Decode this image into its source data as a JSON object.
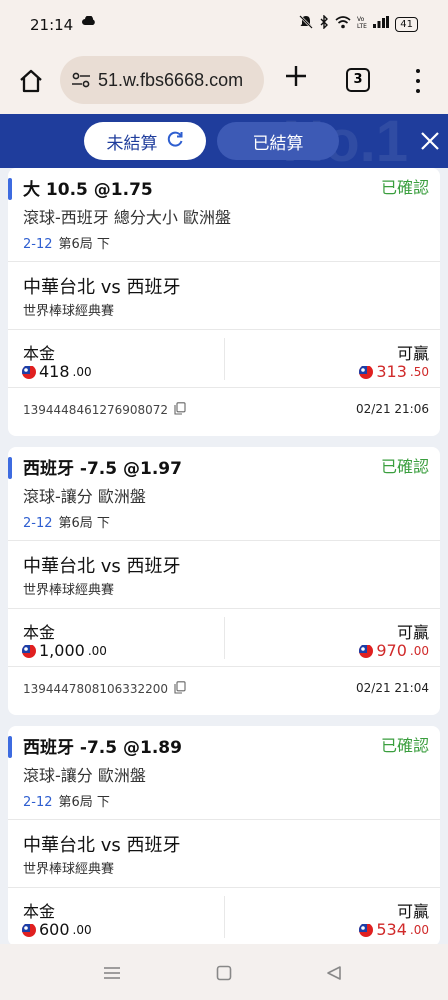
{
  "status_bar": {
    "time": "21:14",
    "battery": "41"
  },
  "browser": {
    "url": "51.w.fbs6668.com",
    "tab_count": "3"
  },
  "tabs": {
    "unsettled": "未結算",
    "settled": "已結算"
  },
  "watermark": "No.1",
  "labels": {
    "stake": "本金",
    "payout": "可贏"
  },
  "bets": [
    {
      "title": "大 10.5 @1.75",
      "status": "已確認",
      "market": "滾球-西班牙 總分大小 歐洲盤",
      "score": "2-12",
      "inning": "第6局 下",
      "match": "中華台北 vs 西班牙",
      "league": "世界棒球經典賽",
      "stake_int": "418",
      "stake_dec": ".00",
      "payout_int": "313",
      "payout_dec": ".50",
      "ticket_id": "1394448461276908072",
      "time": "02/21 21:06"
    },
    {
      "title": "西班牙 -7.5 @1.97",
      "status": "已確認",
      "market": "滾球-讓分 歐洲盤",
      "score": "2-12",
      "inning": "第6局 下",
      "match": "中華台北 vs 西班牙",
      "league": "世界棒球經典賽",
      "stake_int": "1,000",
      "stake_dec": ".00",
      "payout_int": "970",
      "payout_dec": ".00",
      "ticket_id": "1394447808106332200",
      "time": "02/21 21:04"
    },
    {
      "title": "西班牙 -7.5 @1.89",
      "status": "已確認",
      "market": "滾球-讓分 歐洲盤",
      "score": "2-12",
      "inning": "第6局 下",
      "match": "中華台北 vs 西班牙",
      "league": "世界棒球經典賽",
      "stake_int": "600",
      "stake_dec": ".00",
      "payout_int": "534",
      "payout_dec": ".00",
      "ticket_id": "",
      "time": ""
    }
  ],
  "colors": {
    "header_blue": "#1f3d9c",
    "status_green": "#3a9e3e",
    "payout_red": "#d02a2a",
    "score_blue": "#2f5fd0"
  }
}
